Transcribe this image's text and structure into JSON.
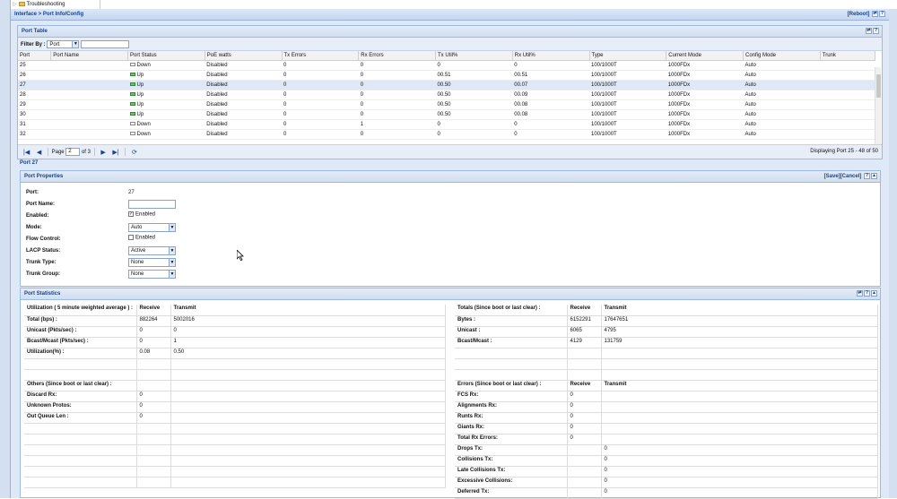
{
  "tree": {
    "item": "Troubleshooting"
  },
  "header": {
    "breadcrumb": "Interface > Port Info/Config",
    "reboot": "[Reboot]"
  },
  "port_table": {
    "title": "Port Table",
    "filter_label": "Filter By :",
    "filter_value": "Port",
    "filter_text": "",
    "columns": [
      "Port",
      "Port Name",
      "Port Status",
      "PoE watts",
      "Tx Errors",
      "Rx Errors",
      "Tx Util%",
      "Rx Util%",
      "Type",
      "Current Mode",
      "Config Mode",
      "Trunk"
    ],
    "rows": [
      {
        "port": "25",
        "name": "",
        "status": "Down",
        "up": false,
        "poe": "Disabled",
        "txerr": "0",
        "rxerr": "0",
        "txutil": "0",
        "rxutil": "0",
        "type": "100/1000T",
        "cur": "1000FDx",
        "cfg": "Auto",
        "trunk": ""
      },
      {
        "port": "26",
        "name": "",
        "status": "Up",
        "up": true,
        "poe": "Disabled",
        "txerr": "0",
        "rxerr": "0",
        "txutil": "00.51",
        "rxutil": "00.51",
        "type": "100/1000T",
        "cur": "1000FDx",
        "cfg": "Auto",
        "trunk": ""
      },
      {
        "port": "27",
        "name": "",
        "status": "Up",
        "up": true,
        "poe": "Disabled",
        "txerr": "0",
        "rxerr": "0",
        "txutil": "00.50",
        "rxutil": "00.07",
        "type": "100/1000T",
        "cur": "1000FDx",
        "cfg": "Auto",
        "trunk": "",
        "selected": true
      },
      {
        "port": "28",
        "name": "",
        "status": "Up",
        "up": true,
        "poe": "Disabled",
        "txerr": "0",
        "rxerr": "0",
        "txutil": "00.50",
        "rxutil": "00.09",
        "type": "100/1000T",
        "cur": "1000FDx",
        "cfg": "Auto",
        "trunk": ""
      },
      {
        "port": "29",
        "name": "",
        "status": "Up",
        "up": true,
        "poe": "Disabled",
        "txerr": "0",
        "rxerr": "0",
        "txutil": "00.50",
        "rxutil": "00.08",
        "type": "100/1000T",
        "cur": "1000FDx",
        "cfg": "Auto",
        "trunk": ""
      },
      {
        "port": "30",
        "name": "",
        "status": "Up",
        "up": true,
        "poe": "Disabled",
        "txerr": "0",
        "rxerr": "0",
        "txutil": "00.50",
        "rxutil": "00.08",
        "type": "100/1000T",
        "cur": "1000FDx",
        "cfg": "Auto",
        "trunk": ""
      },
      {
        "port": "31",
        "name": "",
        "status": "Down",
        "up": false,
        "poe": "Disabled",
        "txerr": "0",
        "rxerr": "1",
        "txutil": "0",
        "rxutil": "0",
        "type": "100/1000T",
        "cur": "1000FDx",
        "cfg": "Auto",
        "trunk": ""
      },
      {
        "port": "32",
        "name": "",
        "status": "Down",
        "up": false,
        "poe": "Disabled",
        "txerr": "0",
        "rxerr": "0",
        "txutil": "0",
        "rxutil": "0",
        "type": "100/1000T",
        "cur": "1000FDx",
        "cfg": "Auto",
        "trunk": ""
      }
    ],
    "pager": {
      "page_label": "Page",
      "page": "2",
      "of": "of 3",
      "display": "Displaying Port 25 - 48 of 50"
    }
  },
  "port_title": "Port 27",
  "props": {
    "title": "Port Properties",
    "save": "[Save]",
    "cancel": "[Cancel]",
    "fields": {
      "port_label": "Port:",
      "port_value": "27",
      "name_label": "Port Name:",
      "enabled_label": "Enabled:",
      "enabled_text": "Enabled",
      "mode_label": "Mode:",
      "mode_value": "Auto",
      "flow_label": "Flow Control:",
      "flow_text": "Enabled",
      "lacp_label": "LACP Status:",
      "lacp_value": "Active",
      "trunk_type_label": "Trunk Type:",
      "trunk_type_value": "None",
      "trunk_group_label": "Trunk Group:",
      "trunk_group_value": "None"
    }
  },
  "stats": {
    "title": "Port Statistics",
    "util": {
      "head": "Utilization ( 5 minute weighted average ) :",
      "rx": "Receive",
      "tx": "Transmit",
      "rows": [
        {
          "label": "Total (bps) :",
          "rx": "882264",
          "tx": "5002016"
        },
        {
          "label": "Unicast (Pkts/sec) :",
          "rx": "0",
          "tx": "0"
        },
        {
          "label": "Bcast/Mcast (Pkts/sec) :",
          "rx": "0",
          "tx": "1"
        },
        {
          "label": "Utilization(%) :",
          "rx": "0.08",
          "tx": "0.50"
        }
      ]
    },
    "totals": {
      "head": "Totals (Since boot or last clear) :",
      "rx": "Receive",
      "tx": "Transmit",
      "rows": [
        {
          "label": "Bytes :",
          "rx": "6152291",
          "tx": "17647651"
        },
        {
          "label": "Unicast :",
          "rx": "6065",
          "tx": "4795"
        },
        {
          "label": "Bcast/Mcast :",
          "rx": "4129",
          "tx": "131759"
        }
      ]
    },
    "others": {
      "head": "Others (Since boot or last clear) :",
      "rows": [
        {
          "label": "Discard Rx:",
          "val": "0"
        },
        {
          "label": "Unknown Protos:",
          "val": "0"
        },
        {
          "label": "Out Queue Len :",
          "val": "0"
        }
      ]
    },
    "errors": {
      "head": "Errors (Since boot or last clear) :",
      "rx": "Receive",
      "tx": "Transmit",
      "rx_rows": [
        {
          "label": "FCS Rx:",
          "val": "0"
        },
        {
          "label": "Alignments Rx:",
          "val": "0"
        },
        {
          "label": "Runts Rx:",
          "val": "0"
        },
        {
          "label": "Giants Rx:",
          "val": "0"
        },
        {
          "label": "Total Rx Errors:",
          "val": "0"
        }
      ],
      "tx_rows": [
        {
          "label": "Drops Tx:",
          "val": "0"
        },
        {
          "label": "Collisions Tx:",
          "val": "0"
        },
        {
          "label": "Late Collisions Tx:",
          "val": "0"
        },
        {
          "label": "Excessive Collisions:",
          "val": "0"
        },
        {
          "label": "Deferred Tx:",
          "val": "0"
        }
      ]
    }
  }
}
